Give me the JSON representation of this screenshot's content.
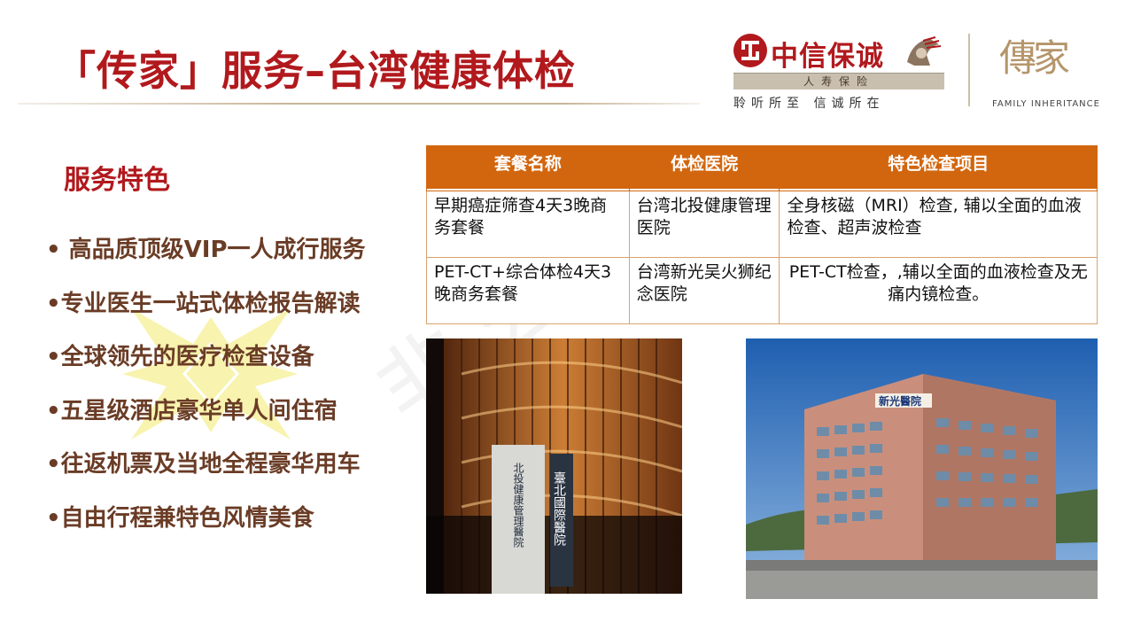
{
  "header": {
    "title": "「传家」服务–台湾健康体检"
  },
  "logo": {
    "name": "中信保诚",
    "subtitle": "人寿保险",
    "slogan": "聆听所至 信诚所在",
    "brand_mark": "傳家",
    "brand_caption": "FAMILY INHERITANCE"
  },
  "features": {
    "heading": "服务特色",
    "items": [
      "• 高品质顶级VIP一人成行服务",
      "•专业医生一站式体检报告解读",
      "•全球领先的医疗检查设备",
      "•五星级酒店豪华单人间住宿",
      "•往返机票及当地全程豪华用车",
      "•自由行程兼特色风情美食"
    ]
  },
  "table": {
    "headers": [
      "套餐名称",
      "体检医院",
      "特色检查项目"
    ],
    "rows": [
      [
        "早期癌症筛查4天3晚商务套餐",
        "台湾北投健康管理医院",
        "全身核磁（MRI）检查, 辅以全面的血液检查、超声波检查"
      ],
      [
        "PET-CT+综合体检4天3晚商务套餐",
        "台湾新光吴火狮纪念医院",
        "PET-CT检查，,辅以全面的血液检查及无痛内镜检查。"
      ]
    ]
  },
  "photos": {
    "photo1_sign": "臺北國際醫院",
    "photo1_sign2": "北投健康管理醫院",
    "photo2_sign": "新光醫院"
  },
  "colors": {
    "title_red": "#b1191d",
    "table_header_orange": "#d2660e",
    "feature_brown": "#6a3c26"
  }
}
